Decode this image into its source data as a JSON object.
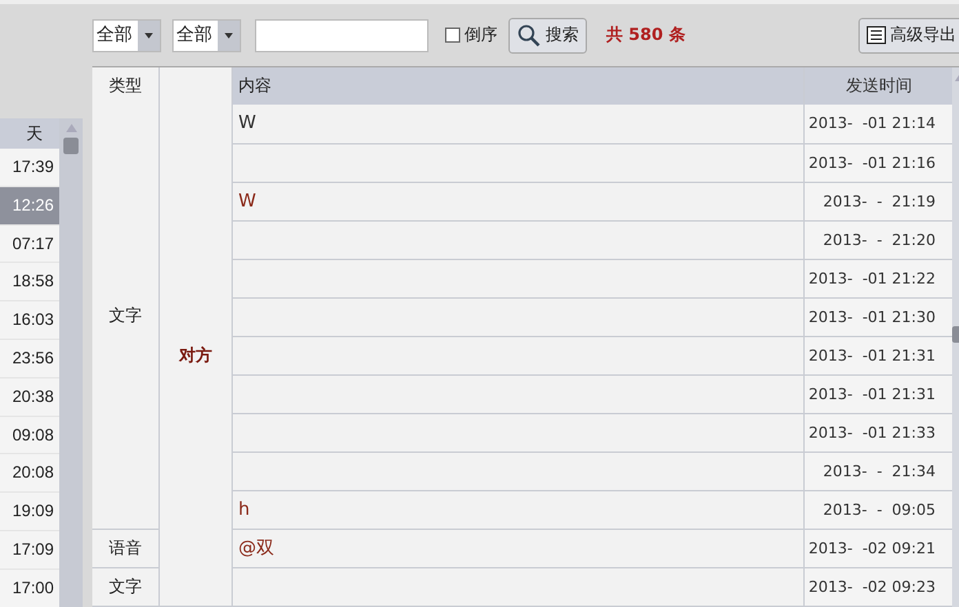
{
  "toolbar": {
    "filters": [
      {
        "value": "全部"
      },
      {
        "value": "全部"
      }
    ],
    "reverse_order": {
      "label": "倒序",
      "checked": false
    },
    "search_button": "搜索",
    "total": "共 580 条",
    "export_button": "高级导出"
  },
  "sidebar": {
    "header": "天",
    "items": [
      {
        "label": "17:39",
        "selected": false
      },
      {
        "label": "12:26",
        "selected": true
      },
      {
        "label": "07:17",
        "selected": false
      },
      {
        "label": "18:58",
        "selected": false
      },
      {
        "label": "16:03",
        "selected": false
      },
      {
        "label": "23:56",
        "selected": false
      },
      {
        "label": "20:38",
        "selected": false
      },
      {
        "label": "09:08",
        "selected": false
      },
      {
        "label": "20:08",
        "selected": false
      },
      {
        "label": "19:09",
        "selected": false
      },
      {
        "label": "17:09",
        "selected": false
      },
      {
        "label": "17:00",
        "selected": false
      }
    ]
  },
  "table": {
    "columns": [
      "类型",
      "内容",
      "发送时间"
    ],
    "sender": "对方",
    "type_groups": [
      {
        "label": "文字",
        "rows": [
          {
            "content": "W",
            "time": "2013-  -01 21:14",
            "color": "#333333"
          },
          {
            "time": "2013-  -01 21:16"
          },
          {
            "content": "W",
            "time": "2013-  -  21:19",
            "color": "#8b2a1a"
          },
          {
            "time": "2013-  -  21:20"
          },
          {
            "time": "2013-  -01 21:22"
          },
          {
            "time": "2013-  -01 21:30"
          },
          {
            "time": "2013-  -01 21:31"
          },
          {
            "time": "2013-  -01 21:31"
          },
          {
            "time": "2013-  -01 21:33"
          },
          {
            "time": "2013-  -  21:34"
          },
          {
            "content": "h",
            "time": "2013-  -  09:05",
            "color": "#8b2a1a"
          }
        ]
      },
      {
        "label": "语音",
        "rows": [
          {
            "content": "@双",
            "time": "2013-  -02 09:21",
            "color": "#8b2a1a"
          }
        ]
      },
      {
        "label": "文字",
        "rows": [
          {
            "time": "2013-  -02 09:23"
          }
        ]
      }
    ]
  }
}
